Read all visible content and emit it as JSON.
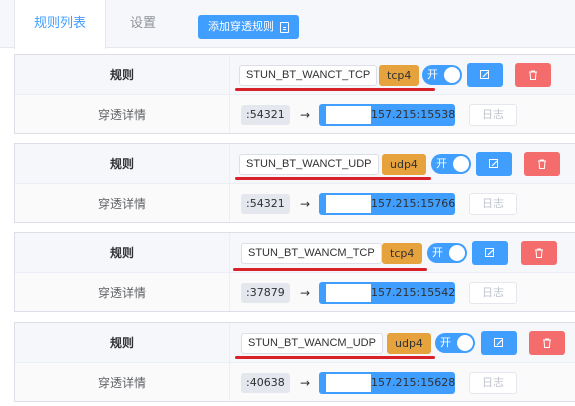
{
  "tabs": {
    "active": "规则列表",
    "settings": "设置"
  },
  "add_button": {
    "label": "添加穿透规则"
  },
  "rules": [
    {
      "label": "规则",
      "name": "STUN_BT_WANCT_TCP",
      "protocol": "tcp4",
      "toggle": "开",
      "detail_label": "穿透详情",
      "port": ":54321",
      "arrow": "→",
      "target_suffix": "157.215:15538",
      "log": "日志"
    },
    {
      "label": "规则",
      "name": "STUN_BT_WANCT_UDP",
      "protocol": "udp4",
      "toggle": "开",
      "detail_label": "穿透详情",
      "port": ":54321",
      "arrow": "→",
      "target_suffix": "157.215:15766",
      "log": "日志"
    },
    {
      "label": "规则",
      "name": "STUN_BT_WANCM_TCP",
      "protocol": "tcp4",
      "toggle": "开",
      "detail_label": "穿透详情",
      "port": ":37879",
      "arrow": "→",
      "target_suffix": "157.215:15542",
      "log": "日志"
    },
    {
      "label": "规则",
      "name": "STUN_BT_WANCM_UDP",
      "protocol": "udp4",
      "toggle": "开",
      "detail_label": "穿透详情",
      "port": ":40638",
      "arrow": "→",
      "target_suffix": "157.215:15628",
      "log": "日志"
    }
  ],
  "colors": {
    "primary": "#409eff",
    "protocol_tag": "#e6a23c",
    "danger": "#f56c6c",
    "annotation": "#d9212a"
  }
}
